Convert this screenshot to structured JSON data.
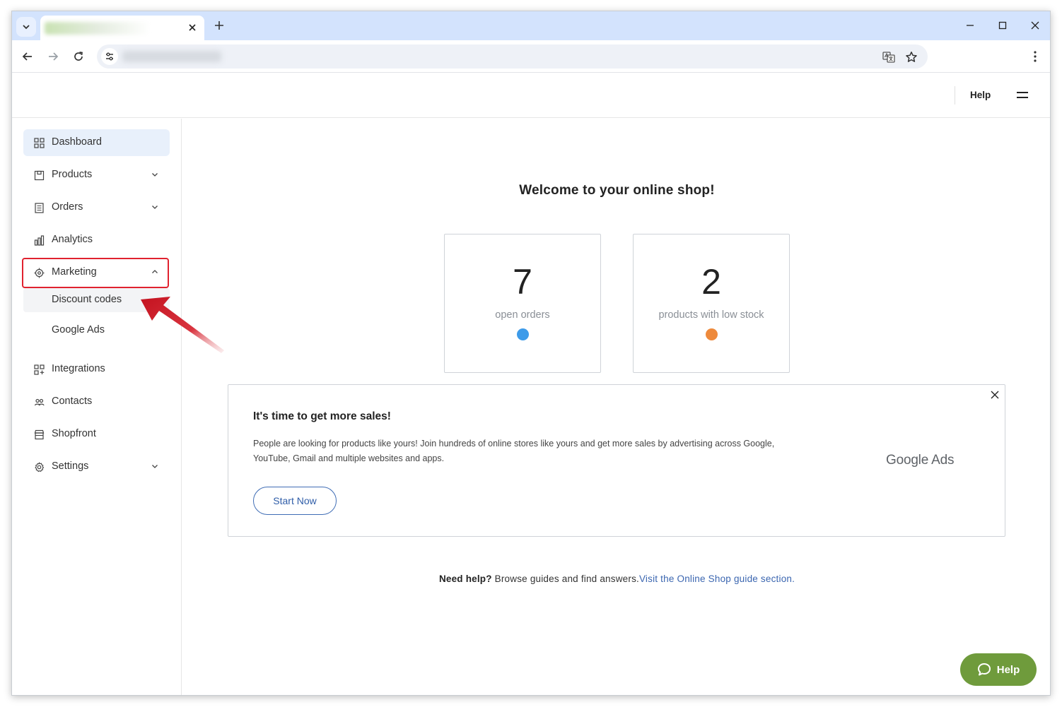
{
  "browser": {
    "new_tab_symbol": "+",
    "tab_close_symbol": "✕"
  },
  "header": {
    "help_label": "Help"
  },
  "sidebar": {
    "items": [
      {
        "label": "Dashboard",
        "icon": "dashboard-grid-icon",
        "active": true
      },
      {
        "label": "Products",
        "icon": "products-box-icon",
        "expandable": true
      },
      {
        "label": "Orders",
        "icon": "orders-list-icon",
        "expandable": true
      },
      {
        "label": "Analytics",
        "icon": "analytics-chart-icon"
      },
      {
        "label": "Marketing",
        "icon": "marketing-target-icon",
        "expanded": true
      },
      {
        "label": "Integrations",
        "icon": "integrations-grid-icon"
      },
      {
        "label": "Contacts",
        "icon": "contacts-people-icon"
      },
      {
        "label": "Shopfront",
        "icon": "shopfront-store-icon"
      },
      {
        "label": "Settings",
        "icon": "settings-gear-icon",
        "expandable": true
      }
    ],
    "marketing_sub": [
      "Discount codes",
      "Google Ads"
    ]
  },
  "main": {
    "welcome": "Welcome to your online shop!",
    "stats": [
      {
        "value": "7",
        "label": "open orders",
        "dot_color": "#3d9be9"
      },
      {
        "value": "2",
        "label": "products with low stock",
        "dot_color": "#ee8a3c"
      }
    ],
    "promo": {
      "title": "It's time to get more sales!",
      "text": "People are looking for products like yours! Join hundreds of online stores like yours and get more sales by advertising across Google, YouTube, Gmail and multiple websites and apps.",
      "button": "Start Now",
      "logo_text": "Google Ads"
    },
    "help_line": {
      "bold": "Need help?",
      "text": " Browse guides and find answers.",
      "link": "Visit the Online Shop guide section."
    }
  },
  "help_fab": {
    "label": "Help"
  },
  "colors": {
    "accent": "#3b66b0",
    "help_fab": "#6f9b3c",
    "highlight_box": "#e0222f"
  }
}
